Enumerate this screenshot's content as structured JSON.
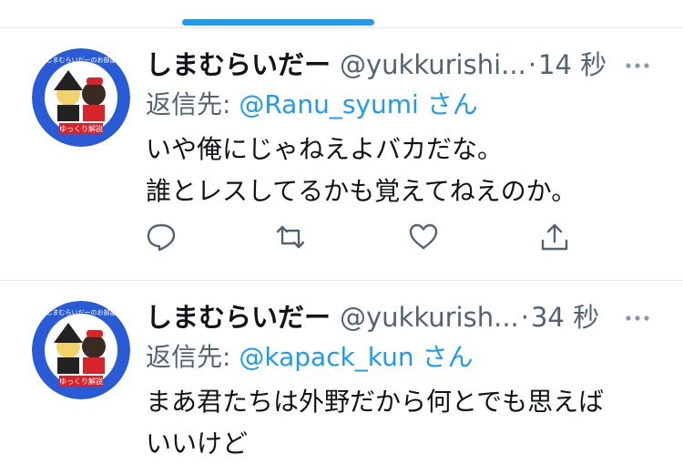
{
  "tweets": [
    {
      "display_name": "しまむらいだー",
      "handle": "@yukkurishi...",
      "separator": "·",
      "time": "14 秒",
      "reply_prefix": "返信先: ",
      "reply_mention": "@Ranu_syumi",
      "reply_suffix": " さん",
      "lines": [
        "いや俺にじゃねえよバカだな。",
        "誰とレスしてるかも覚えてねえのか。"
      ]
    },
    {
      "display_name": "しまむらいだー",
      "handle": "@yukkurish...",
      "separator": "·",
      "time": "34 秒",
      "reply_prefix": "返信先: ",
      "reply_mention": "@kapack_kun",
      "reply_suffix": " さん",
      "lines": [
        "まあ君たちは外野だから何とでも思えば",
        "いいけど"
      ]
    }
  ],
  "avatar": {
    "ring_text": "しまむらいだーのお部屋",
    "banner_text": "ゆっくり解説"
  },
  "colors": {
    "accent": "#1d9bf0",
    "secondary_text": "#536471",
    "avatar_blue": "#2a5bd7"
  }
}
